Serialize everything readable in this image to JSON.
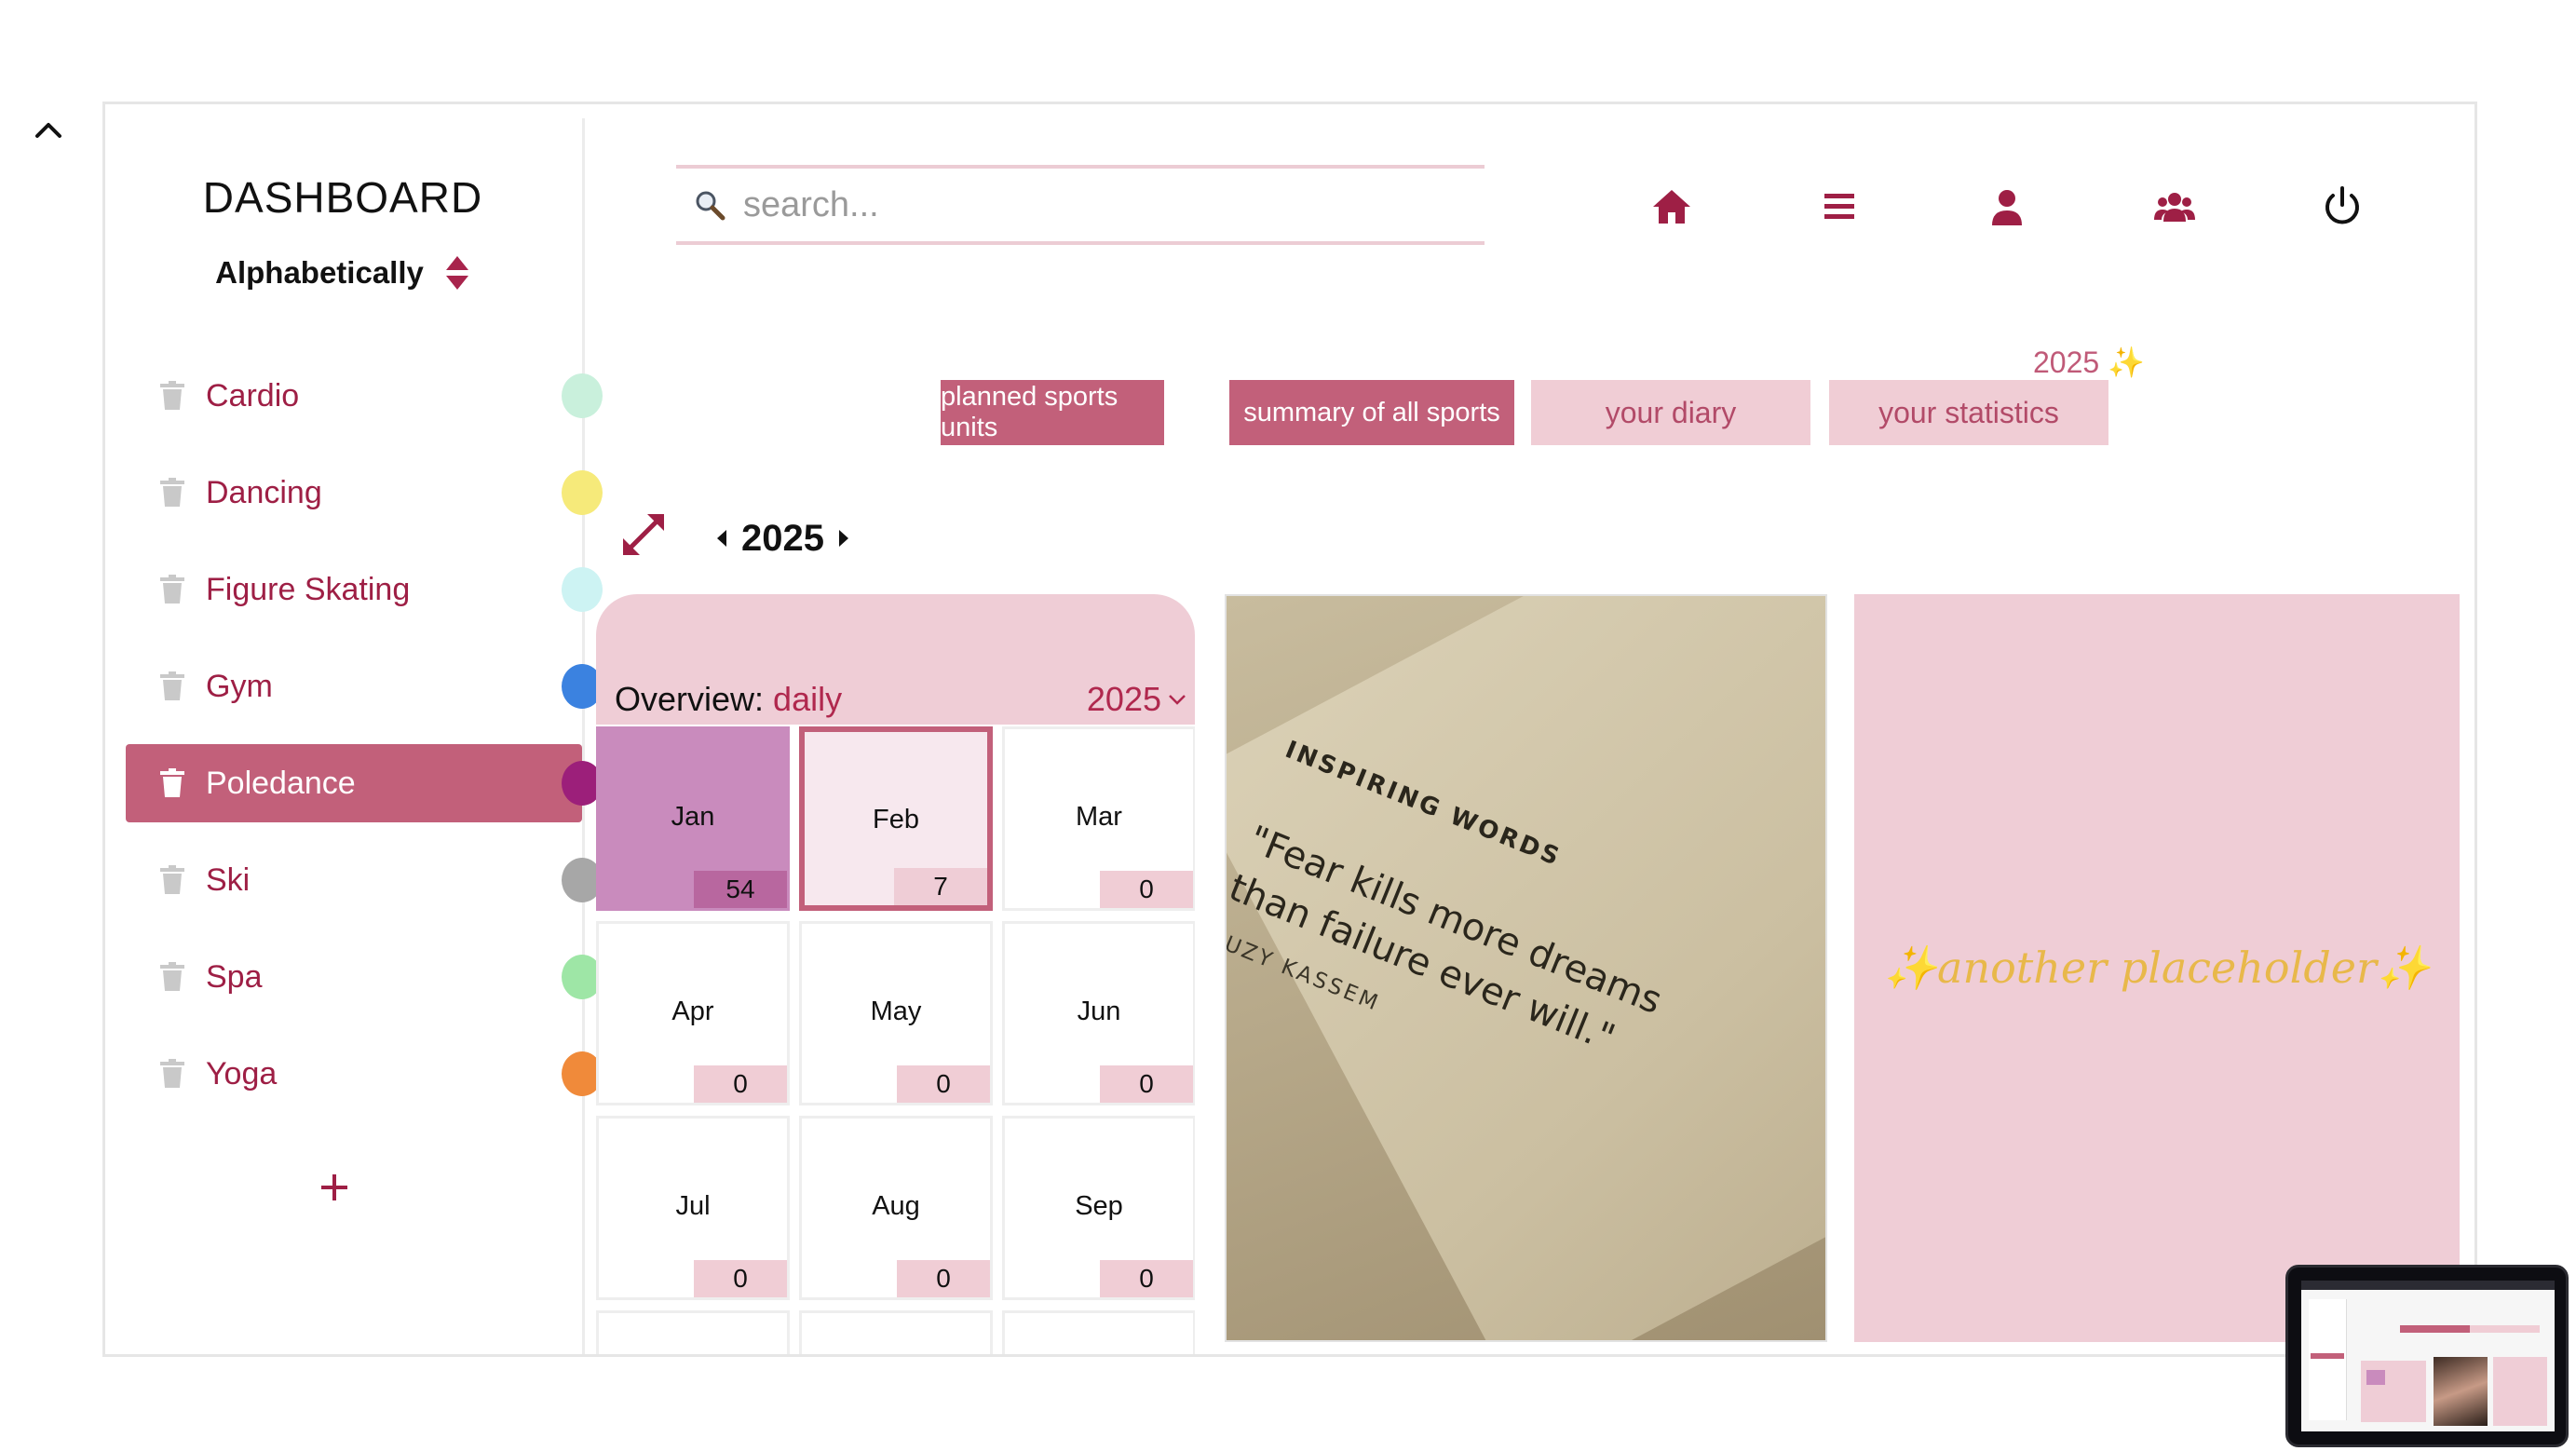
{
  "app": {
    "title": "DASHBOARD",
    "sort_label": "Alphabetically"
  },
  "sports": [
    {
      "label": "Cardio",
      "dot_color": "#c9f0dc",
      "selected": false
    },
    {
      "label": "Dancing",
      "dot_color": "#f6ea7a",
      "selected": false
    },
    {
      "label": "Figure Skating",
      "dot_color": "#cdf3f3",
      "selected": false
    },
    {
      "label": "Gym",
      "dot_color": "#3b82e0",
      "selected": false
    },
    {
      "label": "Poledance",
      "dot_color": "#9c1f7a",
      "selected": true
    },
    {
      "label": "Ski",
      "dot_color": "#a7a7a7",
      "selected": false
    },
    {
      "label": "Spa",
      "dot_color": "#9ee6a6",
      "selected": false
    },
    {
      "label": "Yoga",
      "dot_color": "#f08a3a",
      "selected": false
    }
  ],
  "search": {
    "placeholder": "search..."
  },
  "nav_icons": [
    "home-icon",
    "menu-icon",
    "user-icon",
    "users-icon",
    "power-icon"
  ],
  "year_badge": "2025 ✨",
  "tabs": [
    {
      "label": "planned sports units",
      "active": true
    },
    {
      "label": "summary of all sports",
      "active": true
    },
    {
      "label": "your diary",
      "active": false
    },
    {
      "label": "your statistics",
      "active": false
    }
  ],
  "year_nav": {
    "year": "2025"
  },
  "overview": {
    "label": "Overview:",
    "mode": "daily",
    "year": "2025",
    "months": [
      {
        "name": "Jan",
        "count": "54"
      },
      {
        "name": "Feb",
        "count": "7"
      },
      {
        "name": "Mar",
        "count": "0"
      },
      {
        "name": "Apr",
        "count": "0"
      },
      {
        "name": "May",
        "count": "0"
      },
      {
        "name": "Jun",
        "count": "0"
      },
      {
        "name": "Jul",
        "count": "0"
      },
      {
        "name": "Aug",
        "count": "0"
      },
      {
        "name": "Sep",
        "count": "0"
      }
    ]
  },
  "quote": {
    "heading": "INSPIRING WORDS",
    "line1": "\"Fear kills more dreams",
    "line2": "than failure ever will.\"",
    "author": "SUZY KASSEM"
  },
  "placeholder": {
    "text": "✨another placeholder✨"
  },
  "colors": {
    "accent": "#9e1f45",
    "tab_active": "#c2607a",
    "tab_inactive": "#f0cdd5",
    "card_pink": "#efcdd6",
    "placeholder_gold": "#e8b84a"
  }
}
